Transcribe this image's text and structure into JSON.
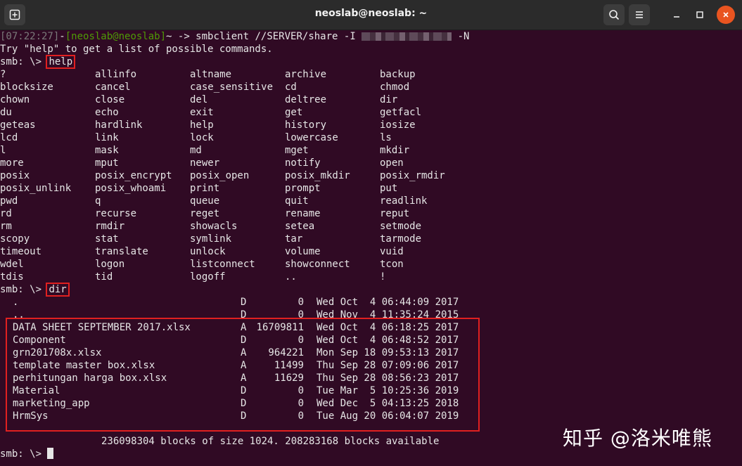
{
  "window": {
    "title": "neoslab@neoslab: ~",
    "accent_close": "#e95420"
  },
  "terminal": {
    "prompt_line": {
      "timestamp": "[07:22:27]",
      "sep": "-",
      "userhost": "[neoslab@neoslab]",
      "cwd": "~",
      "command": " -> smbclient //SERVER/share -I ",
      "after": " -N"
    },
    "intro": "Try \"help\" to get a list of possible commands.",
    "smb_prompt": "smb: \\> ",
    "help_cmd": "help",
    "dir_cmd": "dir",
    "help_rows": [
      [
        "?",
        "allinfo",
        "altname",
        "archive",
        "backup"
      ],
      [
        "blocksize",
        "cancel",
        "case_sensitive",
        "cd",
        "chmod"
      ],
      [
        "chown",
        "close",
        "del",
        "deltree",
        "dir"
      ],
      [
        "du",
        "echo",
        "exit",
        "get",
        "getfacl"
      ],
      [
        "geteas",
        "hardlink",
        "help",
        "history",
        "iosize"
      ],
      [
        "lcd",
        "link",
        "lock",
        "lowercase",
        "ls"
      ],
      [
        "l",
        "mask",
        "md",
        "mget",
        "mkdir"
      ],
      [
        "more",
        "mput",
        "newer",
        "notify",
        "open"
      ],
      [
        "posix",
        "posix_encrypt",
        "posix_open",
        "posix_mkdir",
        "posix_rmdir"
      ],
      [
        "posix_unlink",
        "posix_whoami",
        "print",
        "prompt",
        "put"
      ],
      [
        "pwd",
        "q",
        "queue",
        "quit",
        "readlink"
      ],
      [
        "rd",
        "recurse",
        "reget",
        "rename",
        "reput"
      ],
      [
        "rm",
        "rmdir",
        "showacls",
        "setea",
        "setmode"
      ],
      [
        "scopy",
        "stat",
        "symlink",
        "tar",
        "tarmode"
      ],
      [
        "timeout",
        "translate",
        "unlock",
        "volume",
        "vuid"
      ],
      [
        "wdel",
        "logon",
        "listconnect",
        "showconnect",
        "tcon"
      ],
      [
        "tdis",
        "tid",
        "logoff",
        "..",
        "!"
      ]
    ],
    "dir_rows": [
      {
        "name": ".",
        "attr": "D",
        "size": "0",
        "date": "Wed Oct  4 06:44:09 2017"
      },
      {
        "name": "..",
        "attr": "D",
        "size": "0",
        "date": "Wed Nov  4 11:35:24 2015"
      },
      {
        "name": "DATA SHEET SEPTEMBER 2017.xlsx",
        "attr": "A",
        "size": "16709811",
        "date": "Wed Oct  4 06:18:25 2017"
      },
      {
        "name": "Component",
        "attr": "D",
        "size": "0",
        "date": "Wed Oct  4 06:48:52 2017"
      },
      {
        "name": "grn201708x.xlsx",
        "attr": "A",
        "size": "964221",
        "date": "Mon Sep 18 09:53:13 2017"
      },
      {
        "name": "template master box.xlsx",
        "attr": "A",
        "size": "11499",
        "date": "Thu Sep 28 07:09:06 2017"
      },
      {
        "name": "perhitungan harga box.xlsx",
        "attr": "A",
        "size": "11629",
        "date": "Thu Sep 28 08:56:23 2017"
      },
      {
        "name": "Material",
        "attr": "D",
        "size": "0",
        "date": "Tue Mar  5 10:25:36 2019"
      },
      {
        "name": "marketing_app",
        "attr": "D",
        "size": "0",
        "date": "Wed Dec  5 04:13:25 2018"
      },
      {
        "name": "HrmSys",
        "attr": "D",
        "size": "0",
        "date": "Tue Aug 20 06:04:07 2019"
      }
    ],
    "blocks_summary": "236098304 blocks of size 1024. 208283168 blocks available",
    "final_prompt": "smb: \\> "
  },
  "watermark": "知乎 @洛米唯熊"
}
